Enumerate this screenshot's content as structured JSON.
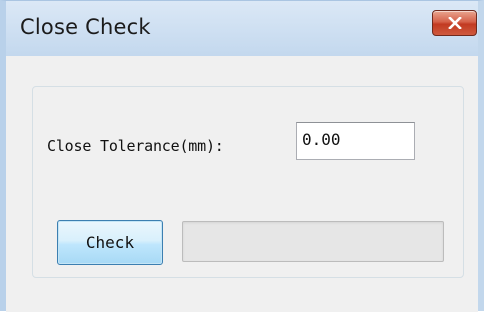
{
  "window": {
    "title": "Close Check",
    "close_icon": "close-x-icon",
    "colors": {
      "frame": "#c7dcf0",
      "client": "#f0f0f0",
      "close_button": "#c23a22",
      "check_button_border": "#3c7fb1"
    }
  },
  "form": {
    "tolerance_label": "Close Tolerance(mm):",
    "tolerance_value": "0.00",
    "check_label": "Check",
    "progress_value": 0
  }
}
